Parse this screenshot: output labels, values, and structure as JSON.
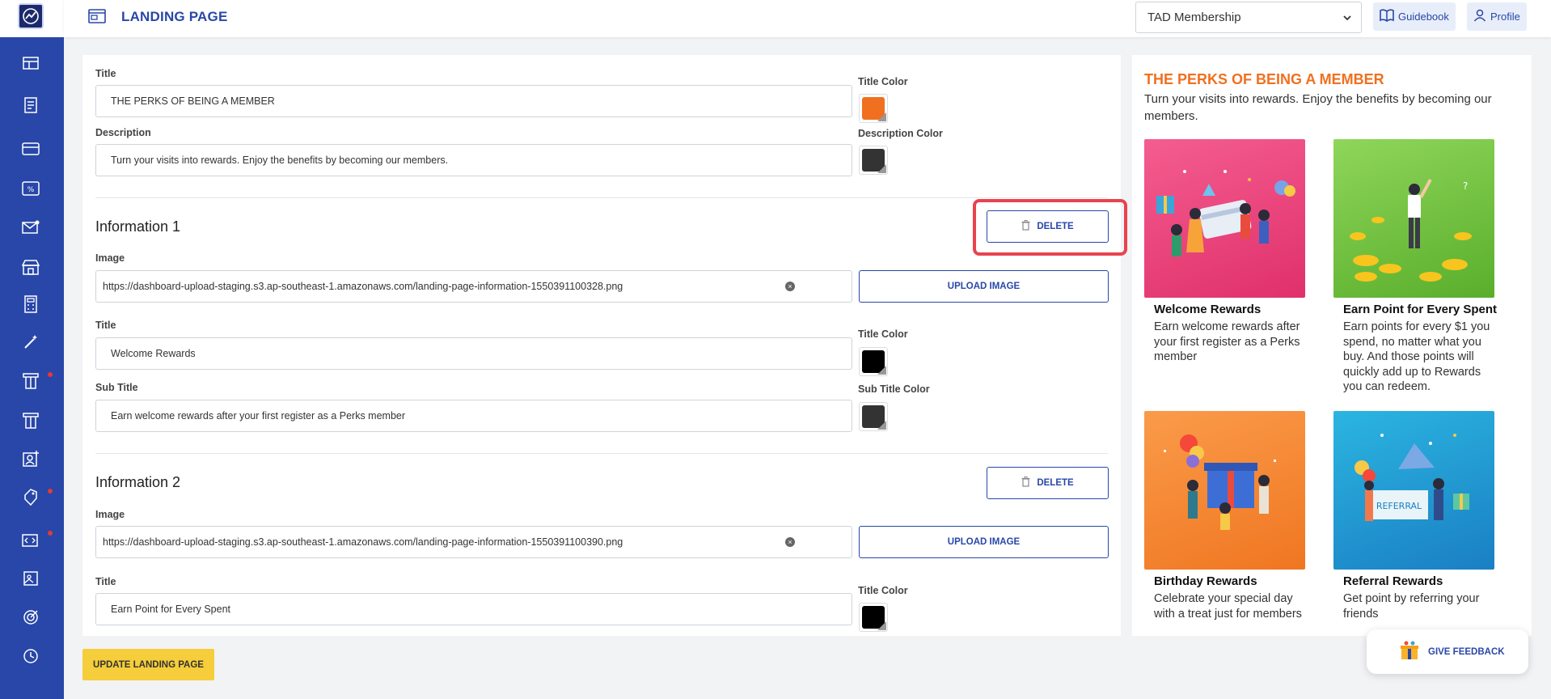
{
  "header": {
    "title": "LANDING PAGE",
    "membership_value": "TAD Membership",
    "guidebook_label": "Guidebook",
    "profile_label": "Profile"
  },
  "sidebar": {
    "icons": [
      "dashboard-icon",
      "document-icon",
      "card-icon",
      "discount-icon",
      "mail-icon",
      "store-icon",
      "calculator-icon",
      "magic-wand-icon",
      "voucher-icon",
      "voucher-alt-icon",
      "user-add-icon",
      "tag-icon",
      "code-icon",
      "gallery-icon",
      "target-icon",
      "history-icon"
    ]
  },
  "header_section": {
    "title_label": "Title",
    "title_value": "THE PERKS OF BEING A MEMBER",
    "title_color_label": "Title Color",
    "description_label": "Description",
    "description_value": "Turn your visits into rewards. Enjoy the benefits by becoming our members.",
    "description_color_label": "Description Color"
  },
  "information": [
    {
      "heading": "Information 1",
      "delete_label": "DELETE",
      "image_label": "Image",
      "image_value": "https://dashboard-upload-staging.s3.ap-southeast-1.amazonaws.com/landing-page-information-1550391100328.png",
      "upload_label": "UPLOAD IMAGE",
      "title_label": "Title",
      "title_value": "Welcome Rewards",
      "title_color_label": "Title Color",
      "subtitle_label": "Sub Title",
      "subtitle_value": "Earn welcome rewards after your first register as a Perks member",
      "subtitle_color_label": "Sub Title Color"
    },
    {
      "heading": "Information 2",
      "delete_label": "DELETE",
      "image_label": "Image",
      "image_value": "https://dashboard-upload-staging.s3.ap-southeast-1.amazonaws.com/landing-page-information-1550391100390.png",
      "upload_label": "UPLOAD IMAGE",
      "title_label": "Title",
      "title_value": "Earn Point for Every Spent",
      "title_color_label": "Title Color"
    }
  ],
  "colors": {
    "title_color": "#f07020",
    "description_color": "#333333",
    "info_title_color": "#000000",
    "info_subtitle_color": "#333333",
    "accent": "#2847a8"
  },
  "update_label": "UPDATE LANDING PAGE",
  "preview": {
    "title": "THE PERKS OF BEING A MEMBER",
    "description": "Turn your visits into rewards. Enjoy the benefits by becoming our members.",
    "cards": [
      {
        "title": "Welcome Rewards",
        "sub": "Earn welcome rewards after your first register as a Perks member"
      },
      {
        "title": "Earn Point for Every Spent",
        "sub": "Earn points for every $1 you spend, no matter what you buy. And those points will quickly add up to Rewards you can redeem."
      },
      {
        "title": "Birthday Rewards",
        "sub": "Celebrate your special day with a treat just for members"
      },
      {
        "title": "Referral Rewards",
        "sub": "Get point by referring your friends"
      }
    ],
    "referral_sign": "REFERRAL"
  },
  "feedback_label": "GIVE FEEDBACK"
}
